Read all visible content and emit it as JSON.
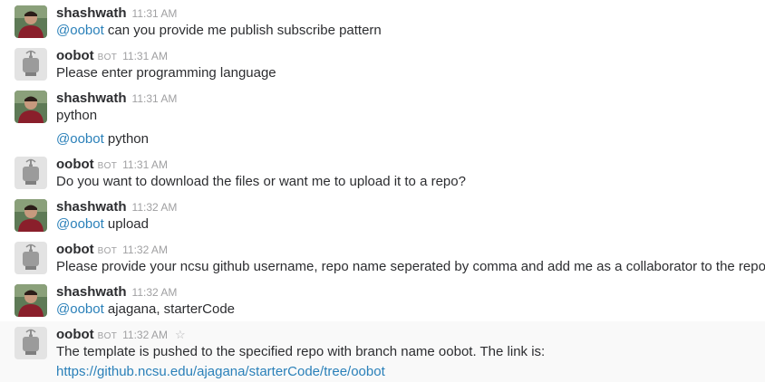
{
  "messages": [
    {
      "sender": "shashwath",
      "time": "11:31 AM",
      "mention": "@oobot",
      "text": " can you provide me publish subscribe pattern"
    },
    {
      "sender": "oobot",
      "badge": "BOT",
      "time": "11:31 AM",
      "text": "Please enter programming language"
    },
    {
      "sender": "shashwath",
      "time": "11:31 AM",
      "text": "python",
      "cont_mention": "@oobot",
      "cont_text": " python"
    },
    {
      "sender": "oobot",
      "badge": "BOT",
      "time": "11:31 AM",
      "text": "Do you want to download the files or want me to upload it to a repo?"
    },
    {
      "sender": "shashwath",
      "time": "11:32 AM",
      "mention": "@oobot",
      "text": " upload"
    },
    {
      "sender": "oobot",
      "badge": "BOT",
      "time": "11:32 AM",
      "text": "Please provide your ncsu github username, repo name seperated by comma and add me as a collaborator to the repo"
    },
    {
      "sender": "shashwath",
      "time": "11:32 AM",
      "mention": "@oobot",
      "text": " ajagana, starterCode"
    },
    {
      "sender": "oobot",
      "badge": "BOT",
      "time": "11:32 AM",
      "text": "The template is pushed to the specified repo with branch name oobot. The link is:",
      "link": "https://github.ncsu.edu/ajagana/starterCode/tree/oobot"
    }
  ],
  "icons": {
    "star": "star-outline-icon",
    "user_avatar": "user-photo-avatar",
    "bot_avatar": "robot-avatar"
  },
  "colors": {
    "mention": "#2a80b9",
    "meta": "#a0a0a2",
    "text": "#2c2d30",
    "hover_row": "#f9f9f9"
  }
}
